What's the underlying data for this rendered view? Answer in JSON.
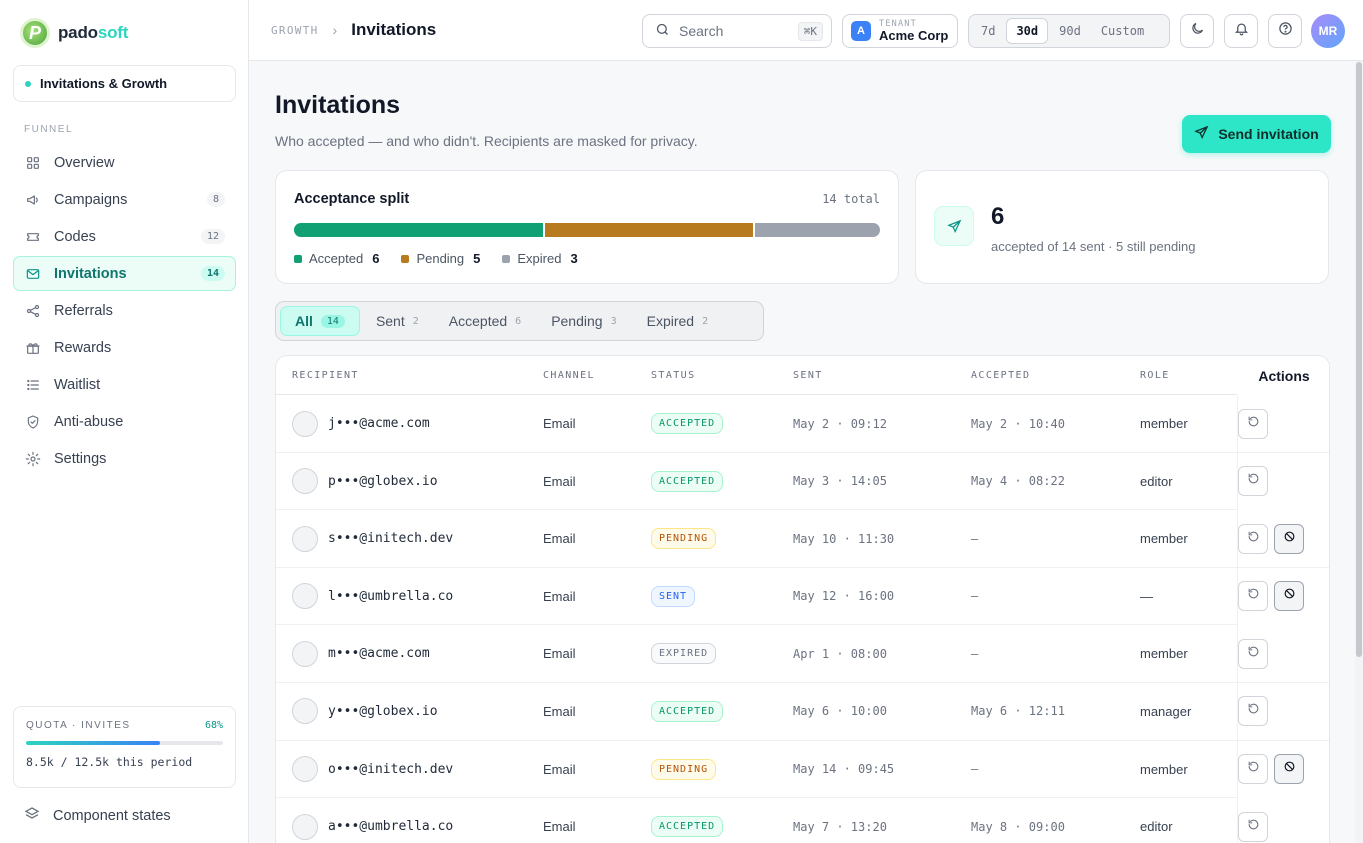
{
  "brand": {
    "name_a": "pado",
    "name_b": "soft",
    "logo_letter": "P"
  },
  "workspace": {
    "label": "Invitations & Growth"
  },
  "sidebar": {
    "section": "FUNNEL",
    "items": [
      {
        "label": "Overview",
        "icon": "grid-icon",
        "count": ""
      },
      {
        "label": "Campaigns",
        "icon": "megaphone-icon",
        "count": "8"
      },
      {
        "label": "Codes",
        "icon": "ticket-icon",
        "count": "12"
      },
      {
        "label": "Invitations",
        "icon": "mail-icon",
        "count": "14"
      },
      {
        "label": "Referrals",
        "icon": "share-icon",
        "count": ""
      },
      {
        "label": "Rewards",
        "icon": "gift-icon",
        "count": ""
      },
      {
        "label": "Waitlist",
        "icon": "list-icon",
        "count": ""
      },
      {
        "label": "Anti-abuse",
        "icon": "shield-icon",
        "count": ""
      },
      {
        "label": "Settings",
        "icon": "gear-icon",
        "count": ""
      }
    ],
    "active_index": 3,
    "quota": {
      "label": "QUOTA · INVITES",
      "pct": "68%",
      "fill": 0.68,
      "usage": "8.5k / 12.5k this period"
    },
    "component_states": "Component states"
  },
  "topbar": {
    "crumb_parent": "GROWTH",
    "crumb_current": "Invitations",
    "search_placeholder": "Search",
    "search_kbd": "⌘K",
    "tenant_label": "TENANT",
    "tenant_name": "Acme Corp",
    "tenant_badge": "A",
    "ranges": [
      "7d",
      "30d",
      "90d",
      "Custom"
    ],
    "range_selected": "30d",
    "avatar_initials": "MR"
  },
  "main": {
    "title": "Invitations",
    "subtitle": "Who accepted — and who didn't. Recipients are masked for privacy.",
    "send_button": "Send invitation"
  },
  "split": {
    "title": "Acceptance split",
    "total": "14 total",
    "segments": [
      {
        "label": "Accepted",
        "value": 6,
        "color": "#10a074"
      },
      {
        "label": "Pending",
        "value": 5,
        "color": "#b87a1f"
      },
      {
        "label": "Expired",
        "value": 3,
        "color": "#9ca3af"
      }
    ]
  },
  "stat": {
    "value": "6",
    "caption": "accepted of 14 sent · 5 still pending"
  },
  "tabs": [
    {
      "label": "All",
      "count": "14"
    },
    {
      "label": "Sent",
      "count": "2"
    },
    {
      "label": "Accepted",
      "count": "6"
    },
    {
      "label": "Pending",
      "count": "3"
    },
    {
      "label": "Expired",
      "count": "2"
    }
  ],
  "table": {
    "headers": [
      "RECIPIENT",
      "CHANNEL",
      "STATUS",
      "SENT",
      "ACCEPTED",
      "ROLE",
      "Actions"
    ],
    "rows": [
      {
        "recipient": "j•••@acme.com",
        "channel": "Email",
        "status": "ACCEPTED",
        "status_kind": "accepted",
        "sent": "May 2 · 09:12",
        "accepted": "May 2 · 10:40",
        "role": "member",
        "revocable": false
      },
      {
        "recipient": "p•••@globex.io",
        "channel": "Email",
        "status": "ACCEPTED",
        "status_kind": "accepted",
        "sent": "May 3 · 14:05",
        "accepted": "May 4 · 08:22",
        "role": "editor",
        "revocable": false
      },
      {
        "recipient": "s•••@initech.dev",
        "channel": "Email",
        "status": "PENDING",
        "status_kind": "pending",
        "sent": "May 10 · 11:30",
        "accepted": "—",
        "role": "member",
        "revocable": true
      },
      {
        "recipient": "l•••@umbrella.co",
        "channel": "Email",
        "status": "SENT",
        "status_kind": "sent",
        "sent": "May 12 · 16:00",
        "accepted": "—",
        "role": "—",
        "revocable": true
      },
      {
        "recipient": "m•••@acme.com",
        "channel": "Email",
        "status": "EXPIRED",
        "status_kind": "expired",
        "sent": "Apr 1 · 08:00",
        "accepted": "—",
        "role": "member",
        "revocable": false
      },
      {
        "recipient": "y•••@globex.io",
        "channel": "Email",
        "status": "ACCEPTED",
        "status_kind": "accepted",
        "sent": "May 6 · 10:00",
        "accepted": "May 6 · 12:11",
        "role": "manager",
        "revocable": false
      },
      {
        "recipient": "o•••@initech.dev",
        "channel": "Email",
        "status": "PENDING",
        "status_kind": "pending",
        "sent": "May 14 · 09:45",
        "accepted": "—",
        "role": "member",
        "revocable": true
      },
      {
        "recipient": "a•••@umbrella.co",
        "channel": "Email",
        "status": "ACCEPTED",
        "status_kind": "accepted",
        "sent": "May 7 · 13:20",
        "accepted": "May 8 · 09:00",
        "role": "editor",
        "revocable": false
      }
    ]
  }
}
